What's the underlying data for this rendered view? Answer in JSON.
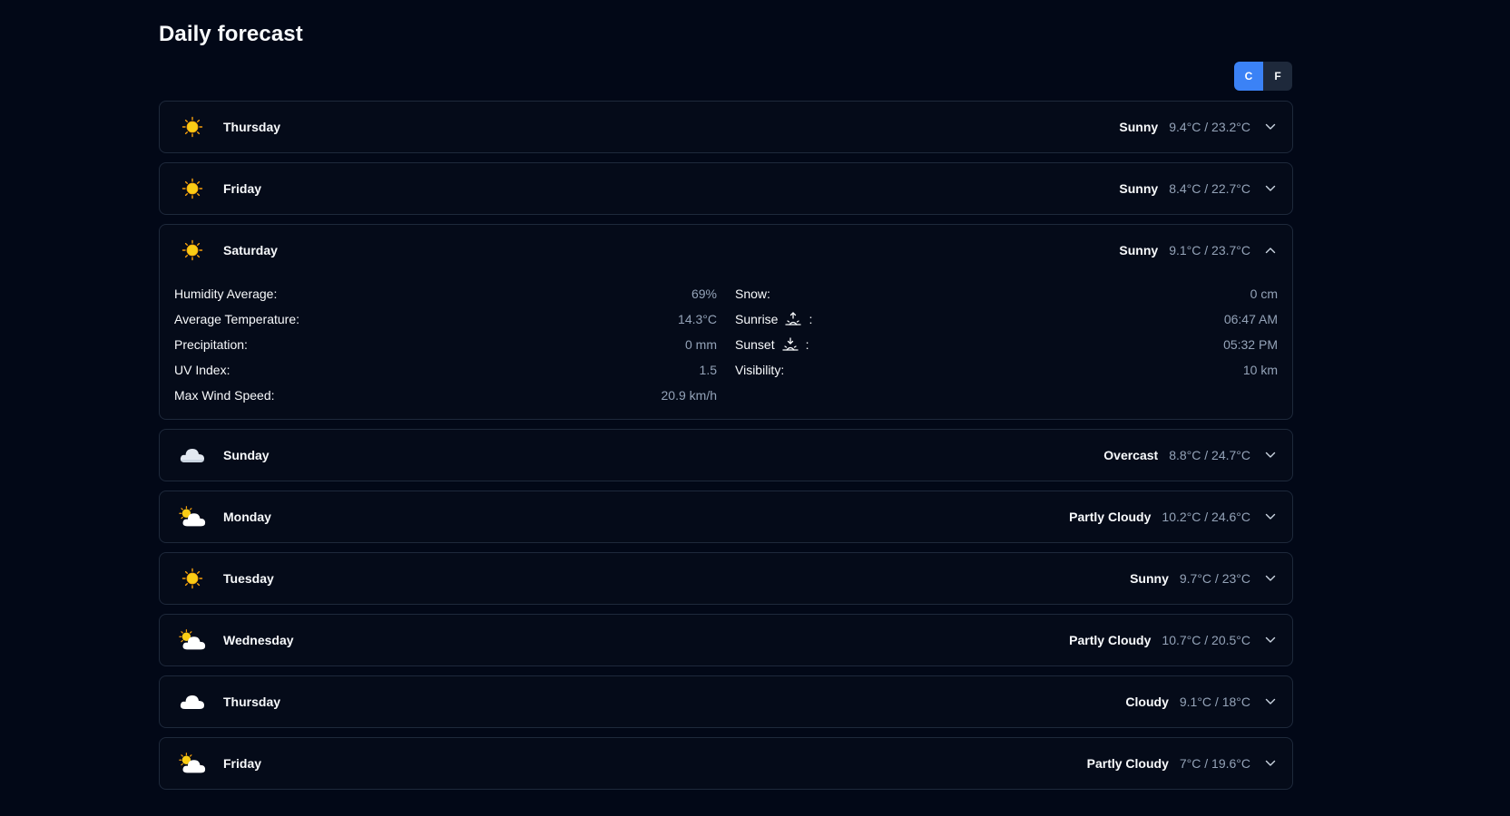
{
  "page": {
    "title": "Daily forecast"
  },
  "units": {
    "celsius": "C",
    "fahrenheit": "F",
    "active": "C"
  },
  "colors": {
    "accent": "#3b82f6",
    "background": "#020817",
    "card": "#050b19",
    "border": "#1e293b",
    "muted": "#94a3b8",
    "sun": "#facc15"
  },
  "days": [
    {
      "name": "Thursday",
      "condition": "Sunny",
      "icon": "sun-icon",
      "temps": "9.4°C / 23.2°C",
      "expanded": false
    },
    {
      "name": "Friday",
      "condition": "Sunny",
      "icon": "sun-icon",
      "temps": "8.4°C / 22.7°C",
      "expanded": false
    },
    {
      "name": "Saturday",
      "condition": "Sunny",
      "icon": "sun-icon",
      "temps": "9.1°C / 23.7°C",
      "expanded": true
    },
    {
      "name": "Sunday",
      "condition": "Overcast",
      "icon": "overcast-icon",
      "temps": "8.8°C / 24.7°C",
      "expanded": false
    },
    {
      "name": "Monday",
      "condition": "Partly Cloudy",
      "icon": "partly-cloudy-icon",
      "temps": "10.2°C / 24.6°C",
      "expanded": false
    },
    {
      "name": "Tuesday",
      "condition": "Sunny",
      "icon": "sun-icon",
      "temps": "9.7°C / 23°C",
      "expanded": false
    },
    {
      "name": "Wednesday",
      "condition": "Partly Cloudy",
      "icon": "partly-cloudy-icon",
      "temps": "10.7°C / 20.5°C",
      "expanded": false
    },
    {
      "name": "Thursday",
      "condition": "Cloudy",
      "icon": "cloud-icon",
      "temps": "9.1°C / 18°C",
      "expanded": false
    },
    {
      "name": "Friday",
      "condition": "Partly Cloudy",
      "icon": "partly-cloudy-icon",
      "temps": "7°C / 19.6°C",
      "expanded": false
    }
  ],
  "details": {
    "left": [
      {
        "label": "Humidity Average:",
        "value": "69%"
      },
      {
        "label": "Average Temperature:",
        "value": "14.3°C"
      },
      {
        "label": "Precipitation:",
        "value": "0 mm"
      },
      {
        "label": "UV Index:",
        "value": "1.5"
      },
      {
        "label": "Max Wind Speed:",
        "value": "20.9 km/h"
      }
    ],
    "right": [
      {
        "label": "Snow:",
        "value": "0 cm"
      },
      {
        "label": "Sunrise",
        "suffix": ":",
        "icon": "sunrise-icon",
        "value": "06:47 AM"
      },
      {
        "label": "Sunset",
        "suffix": ":",
        "icon": "sunset-icon",
        "value": "05:32 PM"
      },
      {
        "label": "Visibility:",
        "value": "10 km"
      }
    ]
  }
}
